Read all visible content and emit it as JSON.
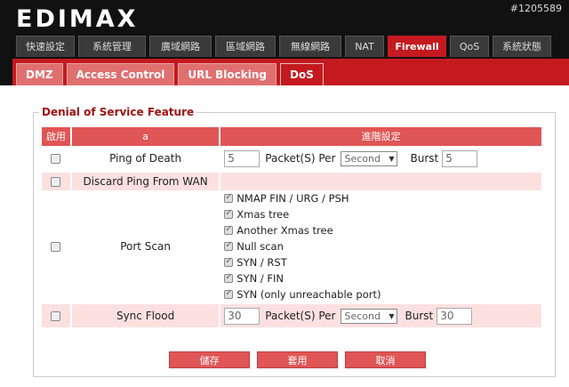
{
  "header": {
    "logo": "EDIMAX",
    "watermark": "#1205589"
  },
  "main_tabs": [
    {
      "label": "快速設定",
      "active": false
    },
    {
      "label": "系統管理",
      "active": false
    },
    {
      "label": "廣域網路",
      "active": false
    },
    {
      "label": "區域網路",
      "active": false
    },
    {
      "label": "無線網路",
      "active": false
    },
    {
      "label": "NAT",
      "active": false
    },
    {
      "label": "Firewall",
      "active": true
    },
    {
      "label": "QoS",
      "active": false
    },
    {
      "label": "系統狀態",
      "active": false
    }
  ],
  "sub_tabs": [
    {
      "label": "DMZ",
      "active": false
    },
    {
      "label": "Access Control",
      "active": false
    },
    {
      "label": "URL Blocking",
      "active": false
    },
    {
      "label": "DoS",
      "active": true
    }
  ],
  "section": {
    "legend": "Denial of Service Feature",
    "headers": {
      "enable": "啟用",
      "name": "a",
      "advanced": "進階設定"
    },
    "rows": {
      "ping_of_death": {
        "name": "Ping of Death",
        "packets": "5",
        "per_label": "Packet(S) Per",
        "unit": "Second",
        "burst_label": "Burst",
        "burst": "5"
      },
      "discard_ping": {
        "name": "Discard Ping From WAN"
      },
      "port_scan": {
        "name": "Port Scan",
        "options": [
          "NMAP FIN / URG / PSH",
          "Xmas tree",
          "Another Xmas tree",
          "Null scan",
          "SYN / RST",
          "SYN / FIN",
          "SYN (only unreachable port)"
        ]
      },
      "sync_flood": {
        "name": "Sync Flood",
        "packets": "30",
        "per_label": "Packet(S) Per",
        "unit": "Second",
        "burst_label": "Burst",
        "burst": "30"
      }
    }
  },
  "buttons": {
    "save": "儲存",
    "apply": "套用",
    "cancel": "取消"
  }
}
